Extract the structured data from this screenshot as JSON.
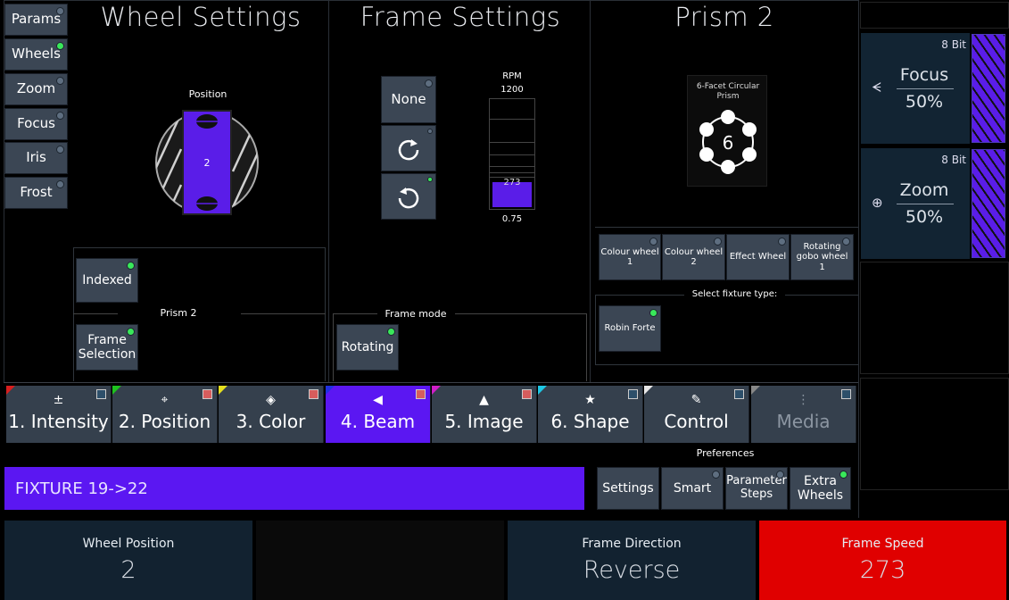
{
  "sidebar": [
    {
      "label": "Params",
      "led": false
    },
    {
      "label": "Wheels",
      "led": true
    },
    {
      "label": "Zoom",
      "led": false
    },
    {
      "label": "Focus",
      "led": false
    },
    {
      "label": "Iris",
      "led": false
    },
    {
      "label": "Frost",
      "led": false
    }
  ],
  "wheel_settings": {
    "title": "Wheel Settings",
    "position_label": "Position",
    "slot_number": "2",
    "indexed_label": "Indexed",
    "prism_label": "Prism 2",
    "frame_selection_label": "Frame Selection"
  },
  "frame_settings": {
    "title": "Frame Settings",
    "none_label": "None",
    "rpm_label": "RPM",
    "rpm_max": "1200",
    "rpm_value": "273",
    "rpm_min": "0.75",
    "rpm_fraction": 0.23,
    "frame_mode_label": "Frame mode",
    "rotating_label": "Rotating"
  },
  "prism": {
    "title": "Prism 2",
    "caption": "6-Facet Circular Prism",
    "facet_count": "6",
    "wheels": [
      "Colour wheel 1",
      "Colour wheel 2",
      "Effect Wheel",
      "Rotating gobo wheel 1"
    ],
    "select_fixture_label": "Select fixture type:",
    "fixture_type": "Robin Forte"
  },
  "tabs": [
    {
      "label": "1. Intensity",
      "icon": "±",
      "corner": "#d81e1e",
      "sq": "#2d4f6a"
    },
    {
      "label": "2. Position",
      "icon": "⌖",
      "corner": "#1ec21e",
      "sq": "#d65d5d"
    },
    {
      "label": "3. Color",
      "icon": "◈",
      "corner": "#e6e01e",
      "sq": "#d65d5d"
    },
    {
      "label": "4. Beam",
      "icon": "◀",
      "corner": "#2030e0",
      "sq": "#d65d5d"
    },
    {
      "label": "5. Image",
      "icon": "▲",
      "corner": "#d01ec8",
      "sq": "#d65d5d"
    },
    {
      "label": "6. Shape",
      "icon": "★",
      "corner": "#1ec8e6",
      "sq": "#2d4f6a"
    },
    {
      "label": "Control",
      "icon": "✎",
      "corner": "#e8e8e8",
      "sq": "#2d4f6a"
    },
    {
      "label": "Media",
      "icon": "⋮",
      "corner": "#888888",
      "sq": "#2d4f6a"
    }
  ],
  "preferences": {
    "title": "Preferences",
    "settings": "Settings",
    "smart": "Smart",
    "parameter_steps": "Parameter Steps",
    "extra_wheels": "Extra Wheels"
  },
  "fixture_bar": "FIXTURE 19->22",
  "encoders": [
    {
      "label": "Wheel Position",
      "value": "2"
    },
    {
      "label": "",
      "value": ""
    },
    {
      "label": "Frame Direction",
      "value": "Reverse"
    },
    {
      "label": "Frame Speed",
      "value": "273"
    }
  ],
  "right_panels": [
    {
      "bits": "8 Bit",
      "name": "Focus",
      "percent": "50%",
      "icon": "focus-icon"
    },
    {
      "bits": "8 Bit",
      "name": "Zoom",
      "percent": "50%",
      "icon": "zoom-icon"
    }
  ],
  "colors": {
    "accent": "#5a1de8",
    "selected_tab": "#5b17f2",
    "frame_speed_bg": "#e00000",
    "button_bg": "#3b4654"
  }
}
